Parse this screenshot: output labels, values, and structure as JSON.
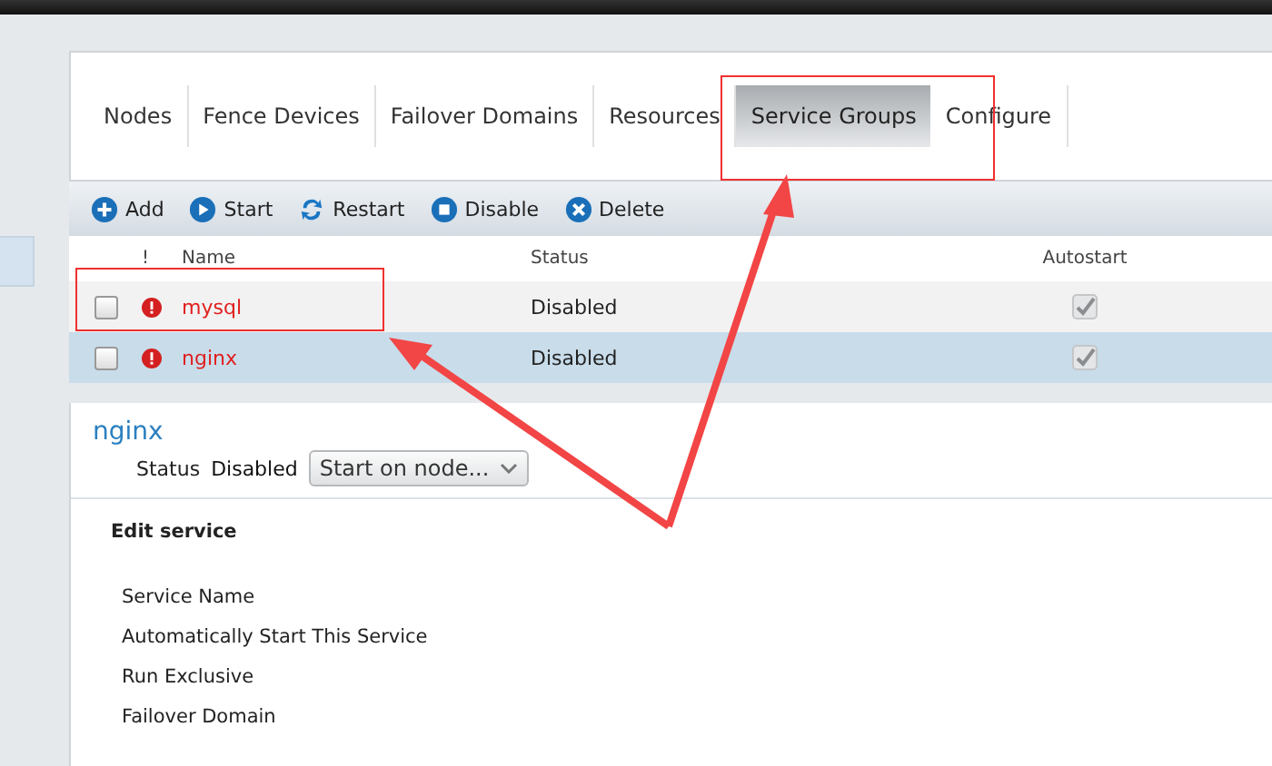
{
  "tabs": [
    {
      "label": "Nodes",
      "selected": false
    },
    {
      "label": "Fence Devices",
      "selected": false
    },
    {
      "label": "Failover Domains",
      "selected": false
    },
    {
      "label": "Resources",
      "selected": false
    },
    {
      "label": "Service Groups",
      "selected": true
    },
    {
      "label": "Configure",
      "selected": false
    }
  ],
  "toolbar": [
    {
      "label": "Add",
      "kind": "add"
    },
    {
      "label": "Start",
      "kind": "start"
    },
    {
      "label": "Restart",
      "kind": "restart"
    },
    {
      "label": "Disable",
      "kind": "disable"
    },
    {
      "label": "Delete",
      "kind": "delete"
    }
  ],
  "table": {
    "columns": [
      "!",
      "Name",
      "Status",
      "Autostart"
    ],
    "rows": [
      {
        "checked": false,
        "selected": false,
        "name": "mysql",
        "status": "Disabled",
        "autostart": true
      },
      {
        "checked": false,
        "selected": true,
        "name": "nginx",
        "status": "Disabled",
        "autostart": true
      }
    ]
  },
  "detail": {
    "title": "nginx",
    "status_label": "Status",
    "status_value": "Disabled",
    "action_select": "Start on node...",
    "section_title": "Edit service",
    "fields": [
      "Service Name",
      "Automatically Start This Service",
      "Run Exclusive",
      "Failover Domain"
    ]
  }
}
